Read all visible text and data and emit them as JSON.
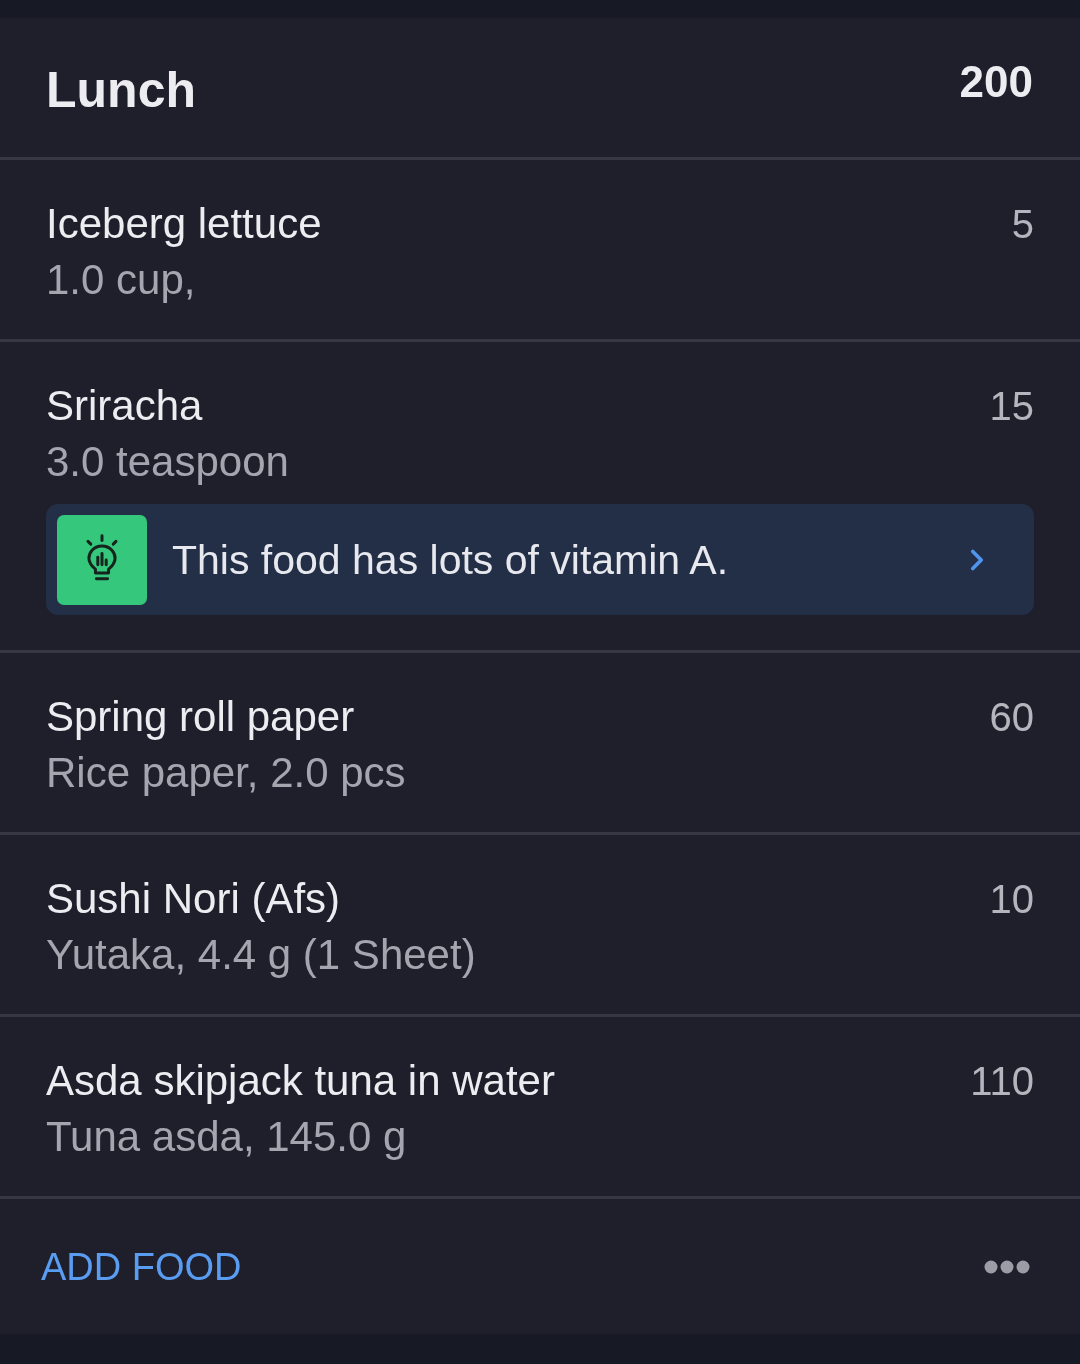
{
  "meal": {
    "title": "Lunch",
    "calories": "200"
  },
  "foods": [
    {
      "name": "Iceberg lettuce",
      "detail": "1.0 cup,",
      "calories": "5"
    },
    {
      "name": "Sriracha",
      "detail": "3.0 teaspoon",
      "calories": "15",
      "tip": {
        "text": "This food has lots of vitamin A."
      }
    },
    {
      "name": "Spring roll paper",
      "detail": "Rice paper, 2.0 pcs",
      "calories": "60"
    },
    {
      "name": "Sushi Nori (Afs)",
      "detail": "Yutaka, 4.4 g (1 Sheet)",
      "calories": "10"
    },
    {
      "name": "Asda skipjack tuna in water",
      "detail": "Tuna asda, 145.0 g",
      "calories": "110"
    }
  ],
  "footer": {
    "add_button": "ADD FOOD"
  }
}
